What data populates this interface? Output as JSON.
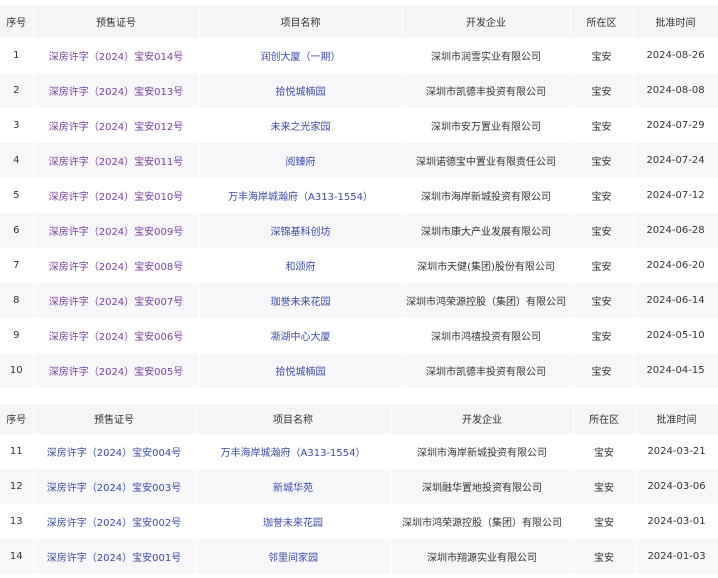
{
  "headers": [
    "序号",
    "预售证号",
    "项目名称",
    "开发企业",
    "所在区",
    "批准时间"
  ],
  "colors": {
    "visited_link": "#7a3fa0",
    "link": "#3a4ba8",
    "header_bg": "#f5f5f5",
    "stripe_bg": "#f7f7f9"
  },
  "table1": {
    "rows": [
      {
        "no": "1",
        "permit": "深房许字（2024）宝安014号",
        "project": "润创大厦（一期）",
        "developer": "深圳市润雪实业有限公司",
        "district": "宝安",
        "date": "2024-08-26",
        "visited": true
      },
      {
        "no": "2",
        "permit": "深房许字（2024）宝安013号",
        "project": "拾悦城楠园",
        "developer": "深圳市凯德丰投资有限公司",
        "district": "宝安",
        "date": "2024-08-08",
        "visited": true
      },
      {
        "no": "3",
        "permit": "深房许字（2024）宝安012号",
        "project": "未来之光家园",
        "developer": "深圳市安万置业有限公司",
        "district": "宝安",
        "date": "2024-07-29",
        "visited": true
      },
      {
        "no": "4",
        "permit": "深房许字（2024）宝安011号",
        "project": "阅臻府",
        "developer": "深圳诺德宝中置业有限责任公司",
        "district": "宝安",
        "date": "2024-07-24",
        "visited": true
      },
      {
        "no": "5",
        "permit": "深房许字（2024）宝安010号",
        "project": "万丰海岸城瀚府（A313-1554）",
        "developer": "深圳市海岸新城投资有限公司",
        "district": "宝安",
        "date": "2024-07-12",
        "visited": true
      },
      {
        "no": "6",
        "permit": "深房许字（2024）宝安009号",
        "project": "深锦基科创坊",
        "developer": "深圳市康大产业发展有限公司",
        "district": "宝安",
        "date": "2024-06-28",
        "visited": true
      },
      {
        "no": "7",
        "permit": "深房许字（2024）宝安008号",
        "project": "和颂府",
        "developer": "深圳市天健(集团)股份有限公司",
        "district": "宝安",
        "date": "2024-06-20",
        "visited": true
      },
      {
        "no": "8",
        "permit": "深房许字（2024）宝安007号",
        "project": "珈誉未来花园",
        "developer": "深圳市鸿荣源控股（集团）有限公司",
        "district": "宝安",
        "date": "2024-06-14",
        "visited": true
      },
      {
        "no": "9",
        "permit": "深房许字（2024）宝安006号",
        "project": "凘湖中心大厦",
        "developer": "深圳市鸿禧投资有限公司",
        "district": "宝安",
        "date": "2024-05-10",
        "visited": true
      },
      {
        "no": "10",
        "permit": "深房许字（2024）宝安005号",
        "project": "拾悦城楠园",
        "developer": "深圳市凯德丰投资有限公司",
        "district": "宝安",
        "date": "2024-04-15",
        "visited": true
      }
    ]
  },
  "table2": {
    "rows": [
      {
        "no": "11",
        "permit": "深房许字（2024）宝安004号",
        "project": "万丰海岸城瀚府（A313-1554）",
        "developer": "深圳市海岸新城投资有限公司",
        "district": "宝安",
        "date": "2024-03-21",
        "visited": false
      },
      {
        "no": "12",
        "permit": "深房许字（2024）宝安003号",
        "project": "新城华苑",
        "developer": "深圳融华置地投资有限公司",
        "district": "宝安",
        "date": "2024-03-06",
        "visited": false
      },
      {
        "no": "13",
        "permit": "深房许字（2024）宝安002号",
        "project": "珈誉未来花园",
        "developer": "深圳市鸿荣源控股（集团）有限公司",
        "district": "宝安",
        "date": "2024-03-01",
        "visited": false
      },
      {
        "no": "14",
        "permit": "深房许字（2024）宝安001号",
        "project": "邻里间家园",
        "developer": "深圳市翔源实业有限公司",
        "district": "宝安",
        "date": "2024-01-03",
        "visited": false
      }
    ]
  }
}
